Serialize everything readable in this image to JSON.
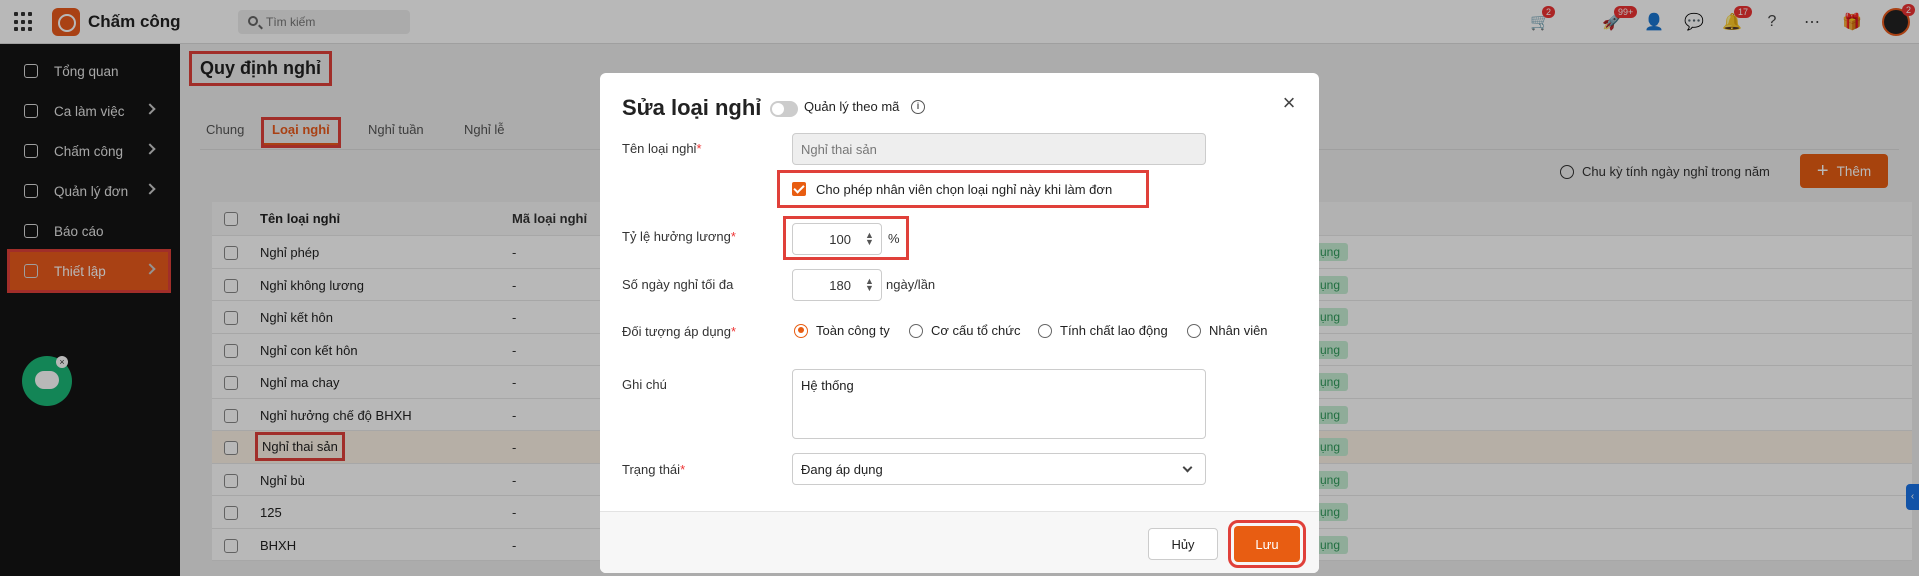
{
  "app": {
    "title": "Chấm công"
  },
  "search": {
    "placeholder": "Tìm kiếm"
  },
  "topbar": {
    "badges": {
      "cart": "2",
      "rocket": "99+",
      "bell": "17",
      "avatar": "2"
    }
  },
  "sidebar": {
    "items": [
      {
        "label": "Tổng quan"
      },
      {
        "label": "Ca làm việc"
      },
      {
        "label": "Chấm công"
      },
      {
        "label": "Quản lý đơn"
      },
      {
        "label": "Báo cáo"
      },
      {
        "label": "Thiết lập"
      }
    ]
  },
  "page": {
    "title": "Quy định nghỉ",
    "tabs": [
      "Chung",
      "Loại nghỉ",
      "Nghỉ tuần",
      "Nghỉ lễ"
    ],
    "cycle_label": "Chu kỳ tính ngày nghỉ trong năm",
    "add_label": "Thêm",
    "add_icon": "+"
  },
  "table": {
    "headers": [
      "Tên loại nghỉ",
      "Mã loại nghỉ"
    ],
    "rows": [
      {
        "name": "Nghỉ phép",
        "code": "-",
        "status": "ụng"
      },
      {
        "name": "Nghỉ không lương",
        "code": "-",
        "status": "ụng"
      },
      {
        "name": "Nghỉ kết hôn",
        "code": "-",
        "status": "ụng"
      },
      {
        "name": "Nghỉ con kết hôn",
        "code": "-",
        "status": "ụng"
      },
      {
        "name": "Nghỉ ma chay",
        "code": "-",
        "status": "ụng"
      },
      {
        "name": "Nghỉ hưởng chế độ BHXH",
        "code": "-",
        "status": "ụng"
      },
      {
        "name": "Nghỉ thai sản",
        "code": "-",
        "status": "ụng"
      },
      {
        "name": "Nghỉ bù",
        "code": "-",
        "status": "ụng"
      },
      {
        "name": "125",
        "code": "-",
        "status": "ụng"
      },
      {
        "name": "BHXH",
        "code": "-",
        "status": "ụng"
      }
    ]
  },
  "modal": {
    "title": "Sửa loại nghỉ",
    "toggle_label": "Quản lý theo mã",
    "close": "×",
    "name_label": "Tên loại nghỉ",
    "name_value": "Nghỉ thai sản",
    "allow_label": "Cho phép nhân viên chọn loại nghỉ này khi làm đơn",
    "rate_label": "Tỷ lệ hưởng lương",
    "rate_value": "100",
    "rate_unit": "%",
    "maxdays_label": "Số ngày nghỉ tối đa",
    "maxdays_value": "180",
    "maxdays_unit": "ngày/lần",
    "target_label": "Đối tượng áp dụng",
    "targets": [
      "Toàn công ty",
      "Cơ cấu tổ chức",
      "Tính chất lao động",
      "Nhân viên"
    ],
    "note_label": "Ghi chú",
    "note_value": "Hệ thống",
    "status_label": "Trạng thái",
    "status_value": "Đang áp dụng",
    "cancel_label": "Hủy",
    "save_label": "Lưu",
    "required_mark": "*"
  }
}
